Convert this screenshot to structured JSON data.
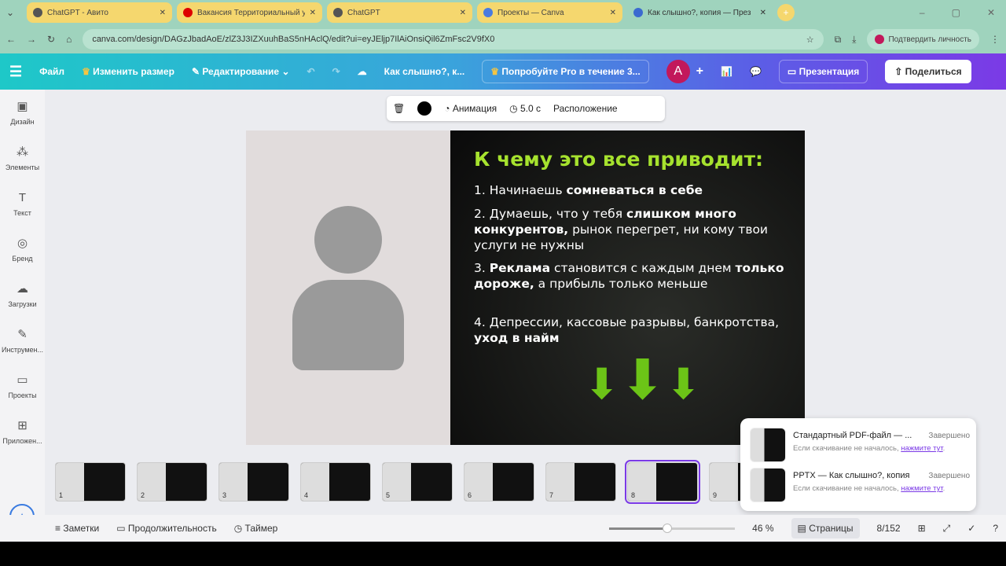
{
  "browser": {
    "tabs": [
      "ChatGPT - Авито",
      "Вакансия Территориальный у",
      "ChatGPT",
      "Проекты — Canva",
      "Как слышно?, копия — През"
    ],
    "url": "canva.com/design/DAGzJbadAoE/zlZ3J3IZXuuhBaS5nHAclQ/edit?ui=eyJEljp7IlAiOnsiQil6ZmFsc2V9fX0",
    "verify": "Подтвердить личность"
  },
  "header": {
    "file": "Файл",
    "resize": "Изменить размер",
    "edit": "Редактирование",
    "title": "Как слышно?, к...",
    "pro": "Попробуйте Pro в течение 3...",
    "avatar": "A",
    "present": "Презентация",
    "share": "Поделиться"
  },
  "sidebar": [
    "Дизайн",
    "Элементы",
    "Текст",
    "Бренд",
    "Загрузки",
    "Инструмен...",
    "Проекты",
    "Приложен..."
  ],
  "toolbar": {
    "animation": "Анимация",
    "duration": "5.0 с",
    "position": "Расположение"
  },
  "slide": {
    "title": "К чему это все приводит:",
    "p1a": "1. Начинаешь ",
    "p1b": "сомневаться в себе",
    "p2a": "2. Думаешь, что у тебя ",
    "p2b": "слишком много конкурентов,",
    "p2c": " рынок перегрет, ни кому твои услуги не нужны",
    "p3a": "3. ",
    "p3b": "Реклама",
    "p3c": " становится с каждым днем ",
    "p3d": "только дороже,",
    "p3e": " а прибыль только меньше",
    "p4a": "4. Депрессии, кассовые разрывы, банкротства, ",
    "p4b": "уход в найм"
  },
  "thumbs": [
    "1",
    "2",
    "3",
    "4",
    "5",
    "6",
    "7",
    "8",
    "9"
  ],
  "downloads": [
    {
      "name": "Стандартный PDF-файл — ...",
      "status": "Завершено",
      "hint": "Если скачивание не началось,",
      "link": "нажмите тут"
    },
    {
      "name": "PPTX — Как слышно?, копия",
      "status": "Завершено",
      "hint": "Если скачивание не началось,",
      "link": "нажмите тут"
    }
  ],
  "bottom": {
    "notes": "Заметки",
    "duration": "Продолжительность",
    "timer": "Таймер",
    "zoom": "46 %",
    "pages": "Страницы",
    "page": "8/152"
  },
  "zoom_percent": 46
}
